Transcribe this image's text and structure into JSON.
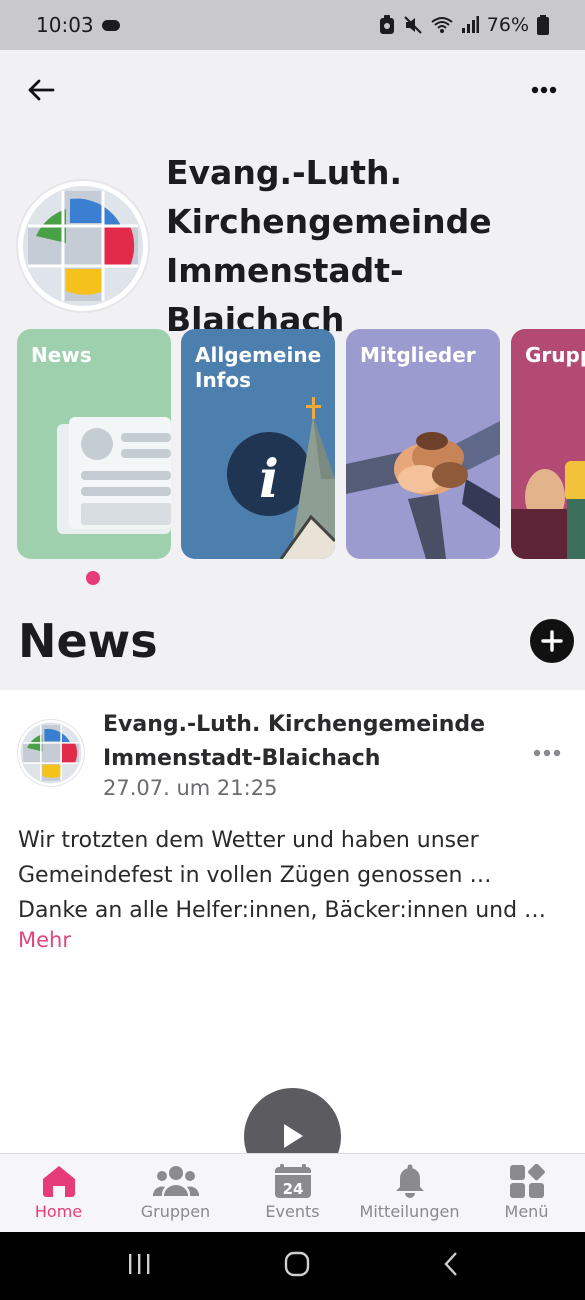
{
  "status_bar": {
    "time": "10:03",
    "battery": "76%",
    "icons": [
      "cloud-icon",
      "nfc-icon",
      "mute-icon",
      "wifi-icon",
      "signal-icon",
      "battery-icon"
    ]
  },
  "app_bar": {
    "back_icon": "arrow-left-icon",
    "more_icon": "more-horizontal-icon"
  },
  "community": {
    "name_line1": "Evang.-Luth.",
    "name_line2": "Kirchengemeinde",
    "name_line3": "Immenstadt-Blaichach"
  },
  "cards": [
    {
      "label": "News",
      "color": "#9fd0ae"
    },
    {
      "label_line1": "Allgemeine",
      "label_line2": "Infos",
      "color": "#4d7fae"
    },
    {
      "label": "Mitglieder",
      "color": "#9b9bcf"
    },
    {
      "label": "Grupp",
      "color": "#b24a74"
    }
  ],
  "news_section": {
    "title": "News",
    "add_icon": "plus-circle-icon"
  },
  "post": {
    "author_line1": "Evang.-Luth. Kirchengemeinde",
    "author_line2": "Immenstadt-Blaichach",
    "timestamp": "27.07. um 21:25",
    "text_lines": [
      "Wir trotzten dem Wetter und haben unser",
      "Gemeindefest in vollen Zügen genossen …",
      "Danke an alle Helfer:innen, Bäcker:innen und …"
    ],
    "more_label": "Mehr"
  },
  "bottom_nav": [
    {
      "label": "Home",
      "icon": "home-icon",
      "active": true
    },
    {
      "label": "Gruppen",
      "icon": "groups-icon",
      "active": false
    },
    {
      "label": "Events",
      "icon": "calendar-icon",
      "badge": "24",
      "active": false
    },
    {
      "label": "Mitteilungen",
      "icon": "bell-icon",
      "active": false
    },
    {
      "label": "Menü",
      "icon": "grid-menu-icon",
      "active": false
    }
  ],
  "colors": {
    "accent": "#e63c78",
    "background": "#f1f1f3"
  }
}
